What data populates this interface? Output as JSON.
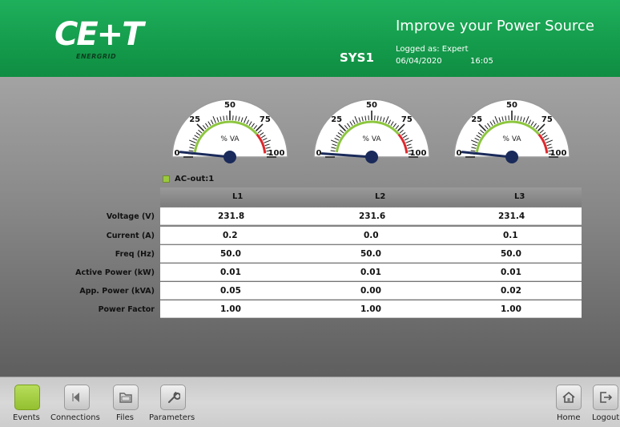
{
  "header": {
    "logo_text": "CE+T",
    "logo_sub": "ENERGRID",
    "system": "SYS1",
    "tagline": "Improve your Power Source",
    "logged_as": "Logged as: Expert",
    "date": "06/04/2020",
    "time": "16:05"
  },
  "gauges": [
    {
      "unit": "% VA",
      "value": 1,
      "scale": {
        "t0": "0",
        "t25": "25",
        "t50": "50",
        "t75": "75",
        "t100": "100"
      }
    },
    {
      "unit": "% VA",
      "value": 0,
      "scale": {
        "t0": "0",
        "t25": "25",
        "t50": "50",
        "t75": "75",
        "t100": "100"
      }
    },
    {
      "unit": "% VA",
      "value": 1,
      "scale": {
        "t0": "0",
        "t25": "25",
        "t50": "50",
        "t75": "75",
        "t100": "100"
      }
    }
  ],
  "colors": {
    "accent": "#16a04f",
    "gauge_green": "#8dc63f",
    "gauge_red": "#e0262b",
    "events_green": "#a6cf45"
  },
  "ac_out": {
    "label": "AC-out:1",
    "indicator_color": "#9bc93d"
  },
  "table": {
    "columns": [
      "L1",
      "L2",
      "L3"
    ],
    "rows": [
      {
        "label": "Voltage (V)",
        "values": [
          "231.8",
          "231.6",
          "231.4"
        ]
      },
      {
        "label": "Current (A)",
        "values": [
          "0.2",
          "0.0",
          "0.1"
        ]
      },
      {
        "label": "Freq (Hz)",
        "values": [
          "50.0",
          "50.0",
          "50.0"
        ]
      },
      {
        "label": "Active Power (kW)",
        "values": [
          "0.01",
          "0.01",
          "0.01"
        ]
      },
      {
        "label": "App. Power (kVA)",
        "values": [
          "0.05",
          "0.00",
          "0.02"
        ]
      },
      {
        "label": "Power Factor",
        "values": [
          "1.00",
          "1.00",
          "1.00"
        ]
      }
    ]
  },
  "nav": {
    "events": {
      "label": "Events",
      "icon": "events-icon"
    },
    "connections": {
      "label": "Connections",
      "icon": "play-icon"
    },
    "files": {
      "label": "Files",
      "icon": "folder-icon"
    },
    "parameters": {
      "label": "Parameters",
      "icon": "wrench-icon"
    },
    "home": {
      "label": "Home",
      "icon": "home-icon"
    },
    "logout": {
      "label": "Logout",
      "icon": "logout-icon"
    }
  }
}
